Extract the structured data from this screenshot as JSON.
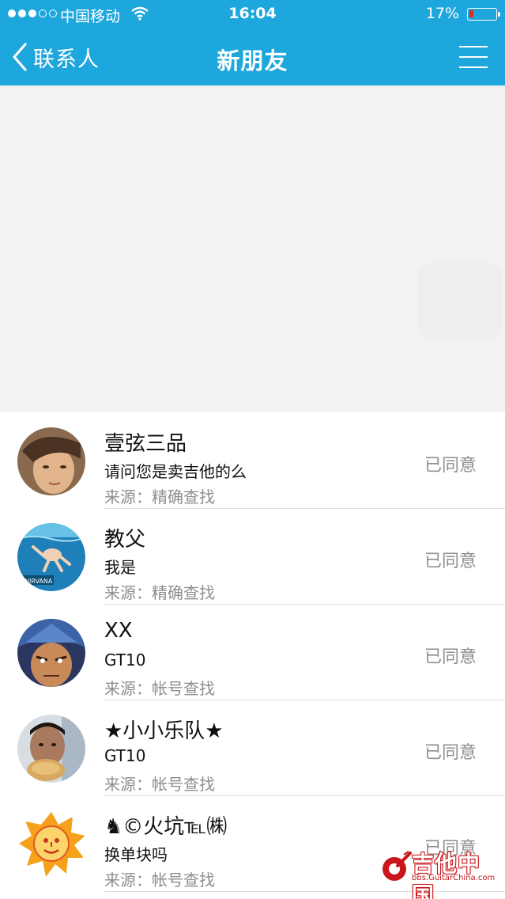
{
  "status_bar": {
    "carrier": "中国移动",
    "time": "16:04",
    "battery": "17%",
    "battery_level": 0.17,
    "signal_strength": 3,
    "signal_total": 5
  },
  "nav": {
    "back_label": "联系人",
    "title": "新朋友"
  },
  "requests": [
    {
      "name": "壹弦三品",
      "message": "请问您是卖吉他的么",
      "source": "来源：精确查找",
      "status": "已同意"
    },
    {
      "name": "教父",
      "message": "我是",
      "source": "来源：精确查找",
      "status": "已同意"
    },
    {
      "name": "XX",
      "message": "GT10",
      "source": "来源：帐号查找",
      "status": "已同意"
    },
    {
      "name": "★小小乐队★",
      "message": "GT10",
      "source": "来源：帐号查找",
      "status": "已同意"
    },
    {
      "name": "♞©火坑℡㈱",
      "message": "换单块吗",
      "source": "来源：帐号查找",
      "status": "已同意"
    }
  ],
  "watermark": {
    "title": "吉他中国",
    "url": "bbs.GuitarChina.com"
  },
  "colors": {
    "nav_bg": "#1ea7dd",
    "banner_bg": "#f2f2f2",
    "secondary_text": "#8e8e8e",
    "watermark_red": "#c9161b"
  },
  "icons": [
    "signal-icon",
    "wifi-icon",
    "battery-icon",
    "back-chevron-icon",
    "menu-icon"
  ]
}
